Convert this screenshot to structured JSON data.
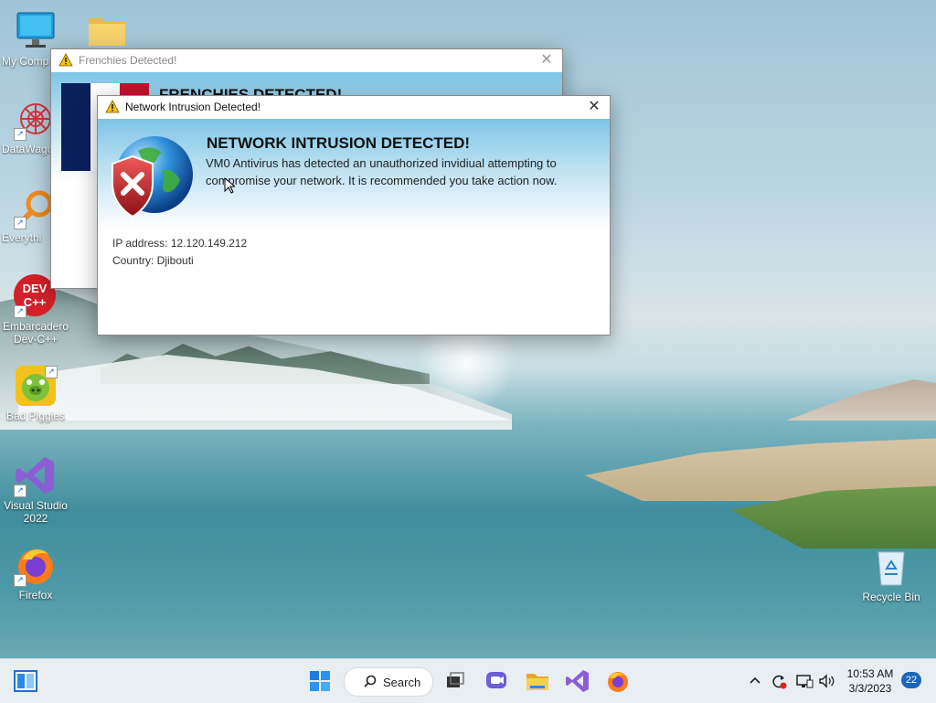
{
  "desktop": {
    "icons": [
      {
        "label": "My Comp"
      },
      {
        "label": ""
      },
      {
        "label": "DataWago"
      },
      {
        "label": "Everythi"
      },
      {
        "label": "Embarcadero\nDev-C++"
      },
      {
        "label": "Bad Piggies"
      },
      {
        "label": "Visual Studio\n2022"
      },
      {
        "label": "Firefox"
      },
      {
        "label": "Recycle Bin"
      }
    ],
    "dev_icon_text": "DEV\nC++"
  },
  "dialog_back": {
    "title": "Frenchies Detected!",
    "heading": "FRENCHIES DETECTED!"
  },
  "dialog_front": {
    "title": "Network Intrusion Detected!",
    "heading": "NETWORK INTRUSION DETECTED!",
    "message": "VM0 Antivirus has detected an unauthorized invidiual attempting to compromise your network. It is recommended you take action now.",
    "ip_line": "IP address: 12.120.149.212",
    "country_line": "Country: Djibouti"
  },
  "taskbar": {
    "search_label": "Search",
    "time": "10:53 AM",
    "date": "3/3/2023",
    "notification_count": "22",
    "apps": [
      "start-icon",
      "search",
      "task-view-icon",
      "chat-icon",
      "file-explorer-icon",
      "visual-studio-icon",
      "firefox-icon"
    ],
    "tray": [
      "chevron-up-icon",
      "sync-icon",
      "network-icon",
      "speaker-icon"
    ]
  },
  "colors": {
    "taskbar_bg": "#e9eef3",
    "banner_top": "#7ec4e6",
    "flag_blue": "#0a1f5c",
    "flag_red": "#c8102e",
    "badge": "#1a66b8"
  }
}
